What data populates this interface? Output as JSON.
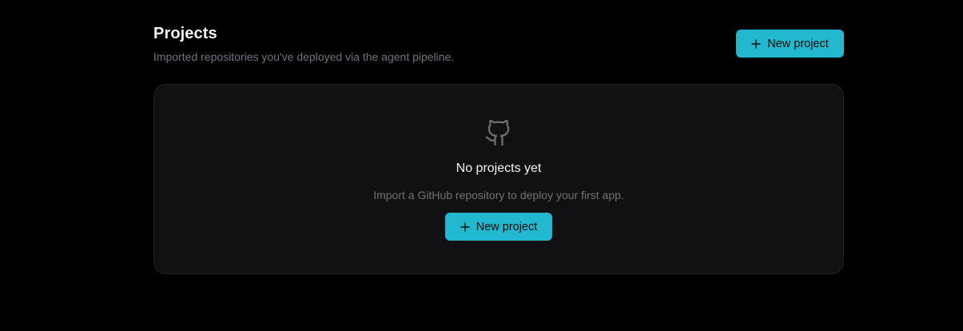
{
  "header": {
    "title": "Projects",
    "subtitle": "Imported repositories you've deployed via the agent pipeline.",
    "new_project_label": "New project"
  },
  "empty_state": {
    "icon": "github-icon",
    "title": "No projects yet",
    "description": "Import a GitHub repository to deploy your first app.",
    "new_project_label": "New project"
  },
  "colors": {
    "background": "#000000",
    "card": "#111113",
    "accent": "#22b8cf",
    "muted_text": "#71717a",
    "text": "#f4f4f5"
  }
}
